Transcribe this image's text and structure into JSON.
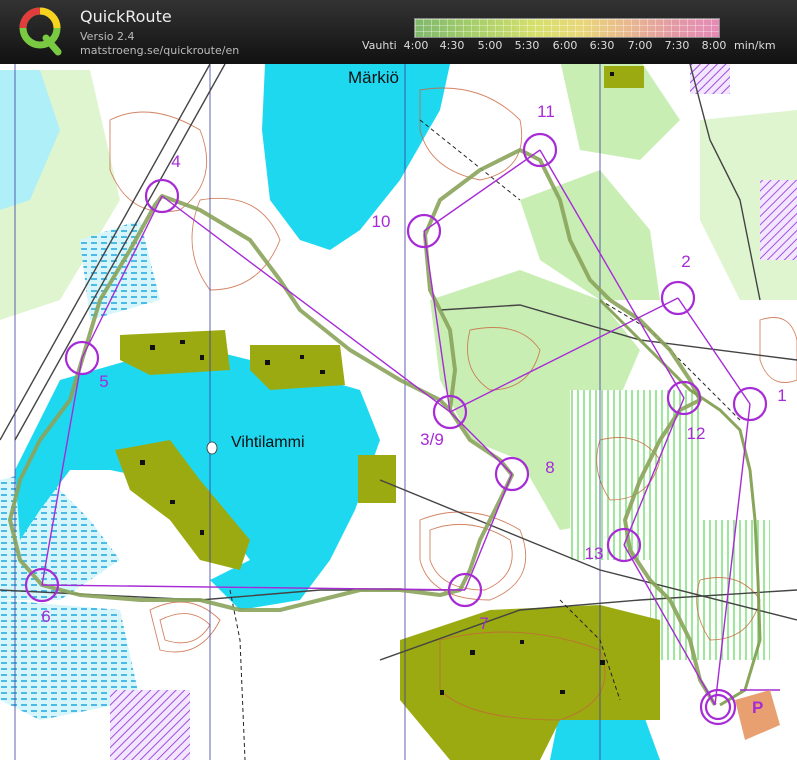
{
  "app": {
    "title": "QuickRoute",
    "version": "Versio 2.4",
    "url": "matstroeng.se/quickroute/en"
  },
  "pace_legend": {
    "label": "Vauhti",
    "ticks": [
      "4:00",
      "4:30",
      "5:00",
      "5:30",
      "6:00",
      "6:30",
      "7:00",
      "7:30",
      "8:00"
    ],
    "unit": "min/km"
  },
  "map": {
    "place_names": {
      "lake_north": "Märkiö",
      "lake_main": "Vihtilammi"
    },
    "controls": [
      {
        "label": "1"
      },
      {
        "label": "2"
      },
      {
        "label": "3/9"
      },
      {
        "label": "4"
      },
      {
        "label": "5"
      },
      {
        "label": "6"
      },
      {
        "label": "7"
      },
      {
        "label": "8"
      },
      {
        "label": "10"
      },
      {
        "label": "11"
      },
      {
        "label": "12"
      },
      {
        "label": "13"
      }
    ],
    "parking_label": "P"
  },
  "colors": {
    "course": "#a62bd6",
    "water": "#1ed8f0",
    "green": "#c9eeb4",
    "olive": "#9aaa10",
    "contour": "#c8643c"
  }
}
